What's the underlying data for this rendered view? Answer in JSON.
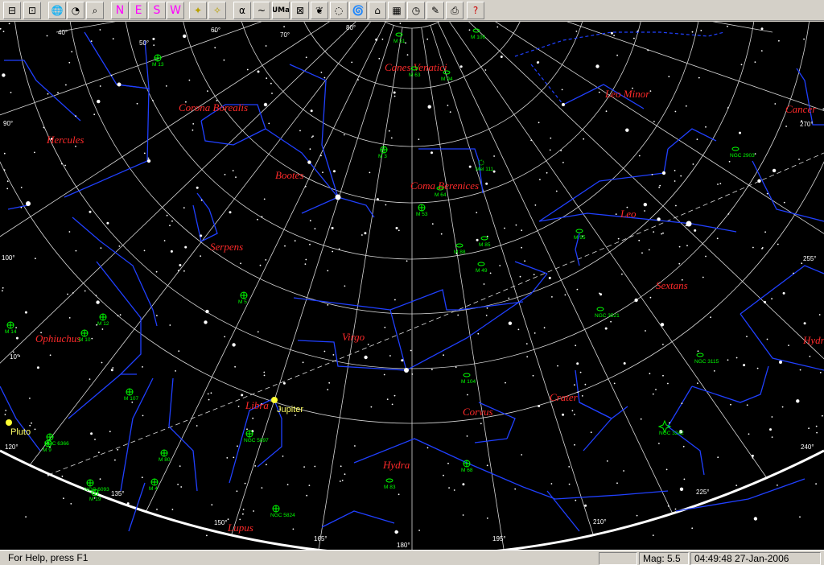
{
  "toolbar": {
    "buttons": [
      {
        "id": "zoom-out",
        "glyph": "⊟"
      },
      {
        "id": "zoom-fit",
        "glyph": "⊡"
      },
      {
        "id": "globe",
        "glyph": "🌐"
      },
      {
        "id": "compass",
        "glyph": "◔"
      },
      {
        "id": "find",
        "glyph": "⌕"
      },
      {
        "id": "north",
        "glyph": "N"
      },
      {
        "id": "east",
        "glyph": "E"
      },
      {
        "id": "south",
        "glyph": "S"
      },
      {
        "id": "west",
        "glyph": "W"
      },
      {
        "id": "stars",
        "glyph": "✦"
      },
      {
        "id": "stars-bright",
        "glyph": "✧"
      },
      {
        "id": "greek",
        "glyph": "α"
      },
      {
        "id": "lines",
        "glyph": "~"
      },
      {
        "id": "const-names",
        "glyph": "UMa"
      },
      {
        "id": "boundaries",
        "glyph": "⊠"
      },
      {
        "id": "milkyway",
        "glyph": "❦"
      },
      {
        "id": "nebula",
        "glyph": "◌"
      },
      {
        "id": "galaxy",
        "glyph": "🌀"
      },
      {
        "id": "horizon",
        "glyph": "⌂"
      },
      {
        "id": "grid",
        "glyph": "▦"
      },
      {
        "id": "clock",
        "glyph": "◷"
      },
      {
        "id": "pencil",
        "glyph": "✎"
      },
      {
        "id": "print",
        "glyph": "⎙"
      },
      {
        "id": "help",
        "glyph": "?"
      }
    ]
  },
  "status": {
    "help": "For Help, press F1",
    "mag": "Mag: 5.5",
    "datetime": "04:49:48 27-Jan-2006"
  },
  "colors": {
    "sky": "#000000",
    "constellation_lines": "#2040ff",
    "constellation_labels": "#ff2a2a",
    "deep_sky": "#00ff00",
    "grid": "#d8d8d8",
    "horizon": "#ffffff",
    "planet": "#ffff33"
  },
  "grid_labels": [
    "40°",
    "50°",
    "60°",
    "70°",
    "80°",
    "90°",
    "100°",
    "10°",
    "120°",
    "135°",
    "150°",
    "165°",
    "180°",
    "195°",
    "210°",
    "225°",
    "240°",
    "255°",
    "270°"
  ],
  "constellations": [
    "Canes Venatici",
    "Corona Borealis",
    "Hercules",
    "Leo Minor",
    "Cancer",
    "Bootes",
    "Coma Berenices",
    "Leo",
    "Serpens",
    "Sextans",
    "Ophiuchus",
    "Virgo",
    "Hydra",
    "Crater",
    "Corvus",
    "Libra",
    "Hydra",
    "Lupus"
  ],
  "deep_sky": [
    "M 51",
    "M 106",
    "M 13",
    "M 63",
    "M 94",
    "NGC 2903",
    "M 3",
    "Mel 111",
    "M 64",
    "M 53",
    "M 85",
    "M 88",
    "M 49",
    "M 95",
    "M 5",
    "NGC 3521",
    "M 14",
    "M 12",
    "M 10",
    "NGC 3115",
    "M 104",
    "M 107",
    "NGC 6366",
    "M 9",
    "NGC 5897",
    "NGC 3242",
    "M 80",
    "M 4",
    "M 68",
    "NGC 6093",
    "M 19",
    "M 83",
    "NGC 5824"
  ],
  "planets": [
    "Jupiter",
    "Pluto"
  ]
}
